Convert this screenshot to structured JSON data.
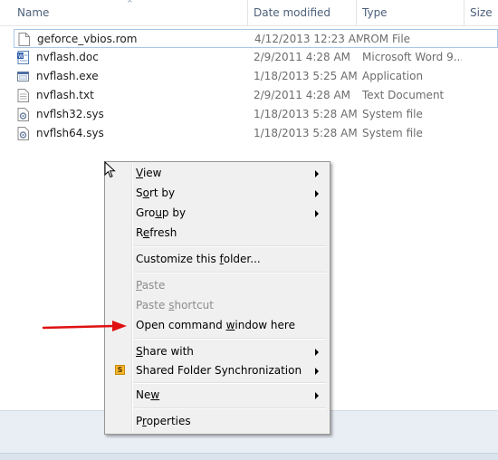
{
  "columns": {
    "name": "Name",
    "date": "Date modified",
    "type": "Type",
    "size": "Size"
  },
  "files": [
    {
      "name": "geforce_vbios.rom",
      "date": "4/12/2013 12:23 AM",
      "type": "ROM File",
      "icon": "blank-file-icon",
      "selected": true
    },
    {
      "name": "nvflash.doc",
      "date": "2/9/2011 4:28 AM",
      "type": "Microsoft Word 9...",
      "icon": "word-doc-icon",
      "selected": false
    },
    {
      "name": "nvflash.exe",
      "date": "1/18/2013 5:25 AM",
      "type": "Application",
      "icon": "application-icon",
      "selected": false
    },
    {
      "name": "nvflash.txt",
      "date": "2/9/2011 4:28 AM",
      "type": "Text Document",
      "icon": "text-file-icon",
      "selected": false
    },
    {
      "name": "nvflsh32.sys",
      "date": "1/18/2013 5:28 AM",
      "type": "System file",
      "icon": "system-file-icon",
      "selected": false
    },
    {
      "name": "nvflsh64.sys",
      "date": "1/18/2013 5:28 AM",
      "type": "System file",
      "icon": "system-file-icon",
      "selected": false
    }
  ],
  "context_menu": {
    "view": {
      "pre": "",
      "u": "V",
      "post": "iew"
    },
    "sort_by": {
      "pre": "S",
      "u": "o",
      "post": "rt by"
    },
    "group_by": {
      "pre": "Gro",
      "u": "u",
      "post": "p by"
    },
    "refresh": {
      "pre": "R",
      "u": "e",
      "post": "fresh"
    },
    "customize": {
      "pre": "Customize this ",
      "u": "f",
      "post": "older..."
    },
    "paste": {
      "pre": "",
      "u": "P",
      "post": "aste"
    },
    "paste_shortcut": {
      "pre": "Paste ",
      "u": "s",
      "post": "hortcut"
    },
    "open_cmd": {
      "pre": "Open command ",
      "u": "w",
      "post": "indow here"
    },
    "share_with": {
      "pre": "",
      "u": "S",
      "post": "hare with"
    },
    "shared_sync": {
      "pre": "Shared Folder Synchronization",
      "u": "",
      "post": "",
      "icon_letter": "S"
    },
    "new": {
      "pre": "Ne",
      "u": "w",
      "post": ""
    },
    "properties": {
      "pre": "P",
      "u": "r",
      "post": "operties"
    }
  },
  "colors": {
    "selection_border": "#a9c8e8",
    "annotation_arrow": "#e01010",
    "menu_background": "#f0f0f0"
  }
}
